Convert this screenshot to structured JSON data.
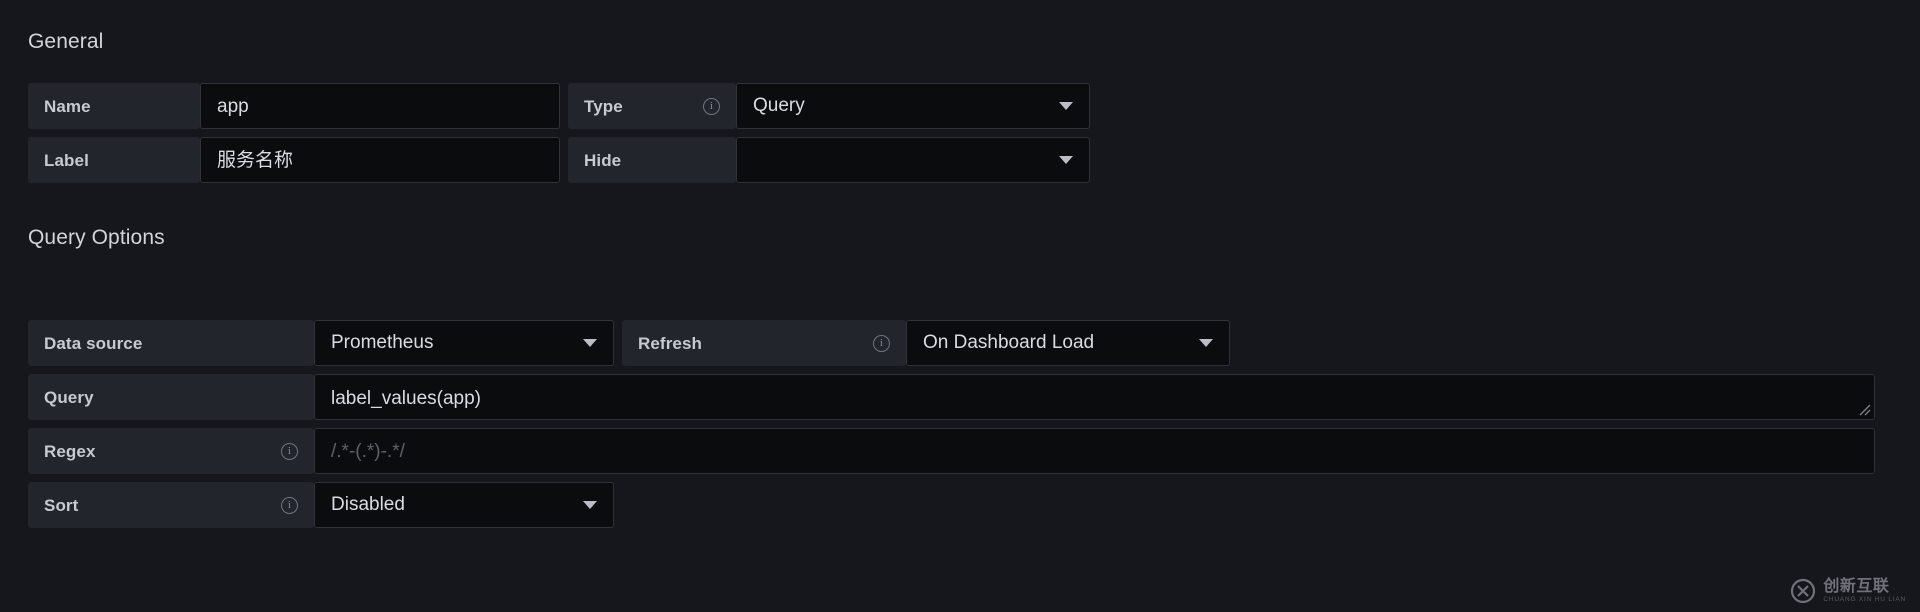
{
  "general": {
    "heading": "General",
    "fields": {
      "name": {
        "label": "Name",
        "value": "app"
      },
      "type": {
        "label": "Type",
        "value": "Query",
        "info_icon": "info-circle-icon",
        "caret_icon": "chevron-down-icon"
      },
      "label": {
        "label": "Label",
        "value": "服务名称"
      },
      "hide": {
        "label": "Hide",
        "value": "",
        "caret_icon": "chevron-down-icon"
      }
    }
  },
  "query_options": {
    "heading": "Query Options",
    "fields": {
      "data_source": {
        "label": "Data source",
        "value": "Prometheus",
        "caret_icon": "chevron-down-icon"
      },
      "refresh": {
        "label": "Refresh",
        "value": "On Dashboard Load",
        "info_icon": "info-circle-icon",
        "caret_icon": "chevron-down-icon"
      },
      "query": {
        "label": "Query",
        "value": "label_values(app)",
        "resize_icon": "resize-grip-icon"
      },
      "regex": {
        "label": "Regex",
        "value": "",
        "placeholder": "/.*-(.*)-.*/",
        "info_icon": "info-circle-icon"
      },
      "sort": {
        "label": "Sort",
        "value": "Disabled",
        "info_icon": "info-circle-icon",
        "caret_icon": "chevron-down-icon"
      }
    }
  },
  "watermark": {
    "logo_icon": "circled-x-logo-icon",
    "text_cn": "创新互联",
    "text_en": "CHUANG XIN HU LIAN"
  },
  "colors": {
    "page_background": "#16171c",
    "label_cell": "#22252b",
    "input_background": "#0b0c0e",
    "input_border": "#2d3139",
    "text_primary": "#d9dce2",
    "text_label": "#c7cad1",
    "text_placeholder": "#5d626b"
  },
  "info_glyph": "i"
}
